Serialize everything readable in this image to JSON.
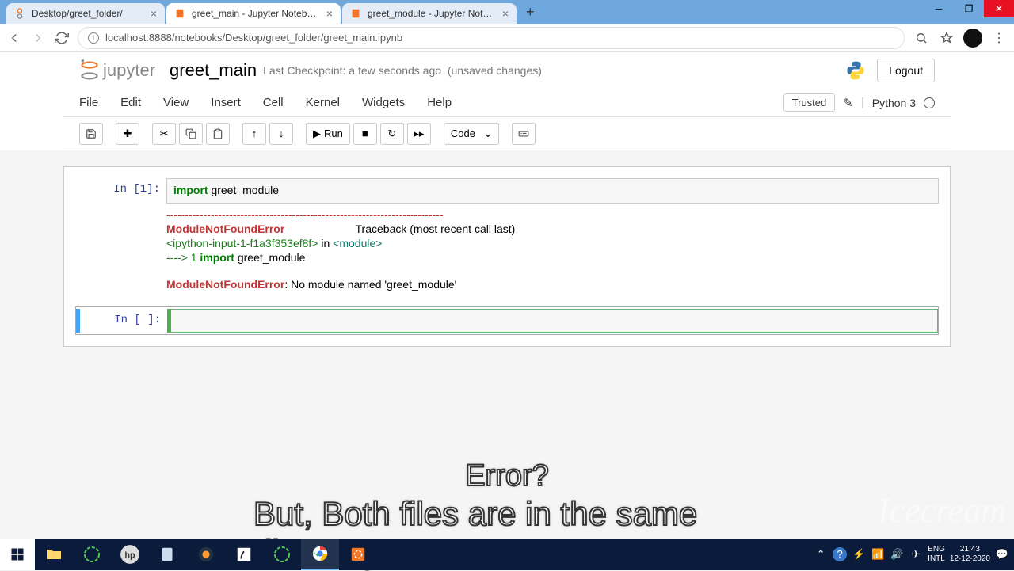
{
  "browser": {
    "tabs": [
      {
        "title": "Desktop/greet_folder/",
        "active": false
      },
      {
        "title": "greet_main - Jupyter Notebook",
        "active": true
      },
      {
        "title": "greet_module - Jupyter Notebo",
        "active": false
      }
    ],
    "url": "localhost:8888/notebooks/Desktop/greet_folder/greet_main.ipynb"
  },
  "jupyter": {
    "logo_text": "jupyter",
    "notebook_name": "greet_main",
    "checkpoint": "Last Checkpoint: a few seconds ago",
    "unsaved": "(unsaved changes)",
    "logout": "Logout",
    "menu": [
      "File",
      "Edit",
      "View",
      "Insert",
      "Cell",
      "Kernel",
      "Widgets",
      "Help"
    ],
    "trusted": "Trusted",
    "kernel": "Python 3",
    "run_label": "Run",
    "cell_type": "Code"
  },
  "cells": {
    "cell1": {
      "prompt": "In [1]:",
      "code_kw": "import",
      "code_rest": " greet_module",
      "out_sep": "---------------------------------------------------------------------------",
      "out_err1_name": "ModuleNotFoundError",
      "out_err1_trace": "                       Traceback (most recent call last)",
      "out_loc1": "<ipython-input-1-f1a3f353ef8f>",
      "out_loc_in": " in ",
      "out_loc_mod": "<module>",
      "out_arrow": "----> 1 ",
      "out_import_kw": "import",
      "out_import_rest": " greet_module",
      "out_err2_name": "ModuleNotFoundError",
      "out_err2_msg": ": No module named 'greet_module'"
    },
    "cell2": {
      "prompt": "In [ ]:"
    }
  },
  "captions": {
    "line1": "Error?",
    "line2": "But, Both files are in the same directory"
  },
  "watermark": "Icecream",
  "taskbar": {
    "lang1": "ENG",
    "lang2": "INTL",
    "time": "21:43",
    "date": "12-12-2020"
  }
}
